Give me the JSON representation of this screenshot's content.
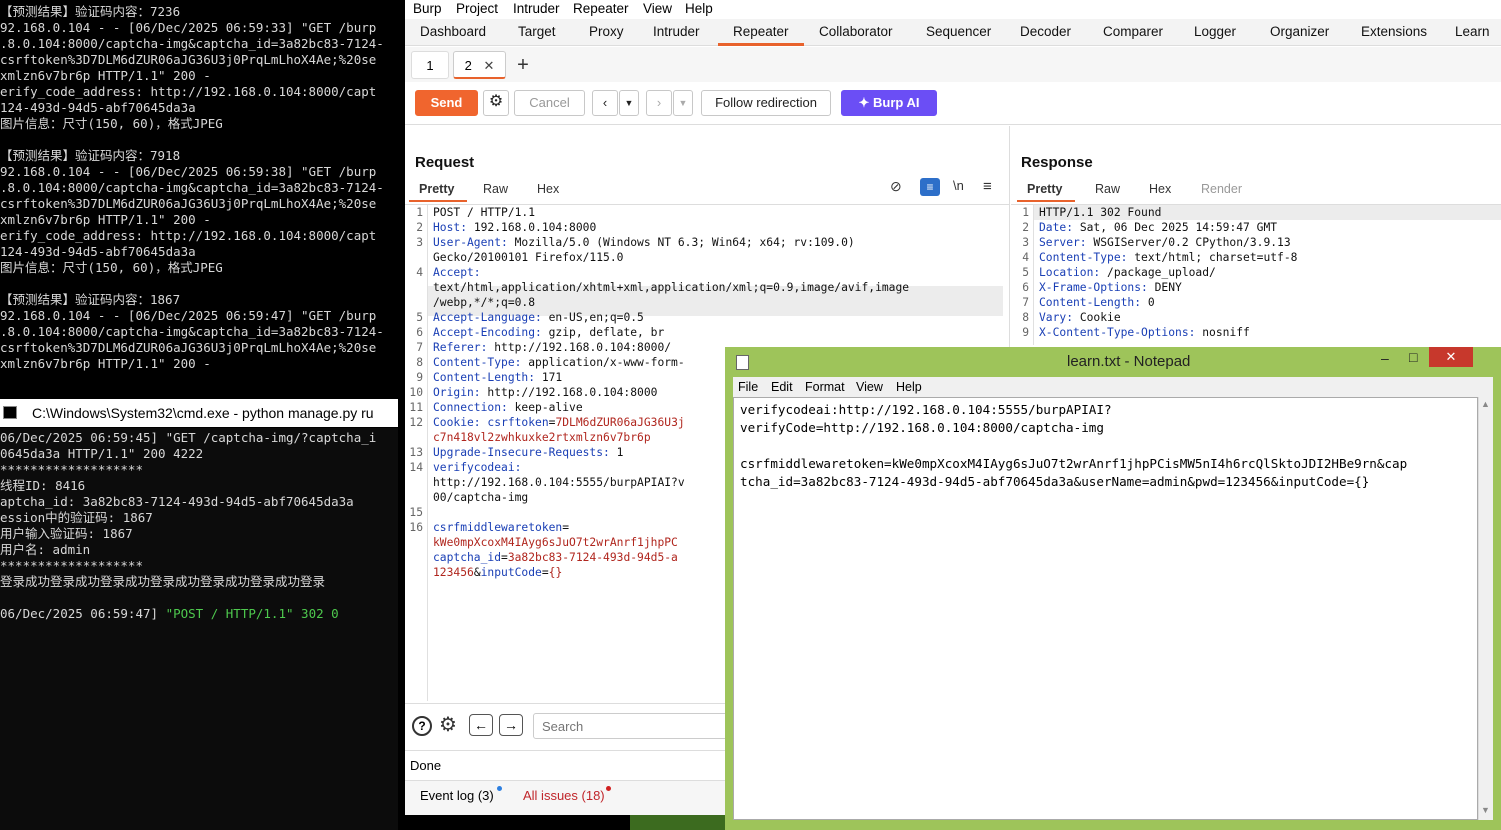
{
  "term1": {
    "lines": [
      "【预测结果】验证码内容：7236",
      "92.168.0.104 - - [06/Dec/2025 06:59:33] \"GET /burp",
      ".8.0.104:8000/captcha-img&captcha_id=3a82bc83-7124-",
      "csrftoken%3D7DLM6dZUR06aJG36U3j0PrqLmLhoX4Ae;%20se",
      "xmlzn6v7br6p HTTP/1.1\" 200 -",
      "erify_code_address: http://192.168.0.104:8000/capt",
      "124-493d-94d5-abf70645da3a",
      "图片信息：尺寸(150, 60)，格式JPEG",
      "",
      "【预测结果】验证码内容：7918",
      "92.168.0.104 - - [06/Dec/2025 06:59:38] \"GET /burp",
      ".8.0.104:8000/captcha-img&captcha_id=3a82bc83-7124-",
      "csrftoken%3D7DLM6dZUR06aJG36U3j0PrqLmLhoX4Ae;%20se",
      "xmlzn6v7br6p HTTP/1.1\" 200 -",
      "erify_code_address: http://192.168.0.104:8000/capt",
      "124-493d-94d5-abf70645da3a",
      "图片信息：尺寸(150, 60)，格式JPEG",
      "",
      "【预测结果】验证码内容：1867",
      "92.168.0.104 - - [06/Dec/2025 06:59:47] \"GET /burp",
      ".8.0.104:8000/captcha-img&captcha_id=3a82bc83-7124-",
      "csrftoken%3D7DLM6dZUR06aJG36U3j0PrqLmLhoX4Ae;%20se",
      "xmlzn6v7br6p HTTP/1.1\" 200 -"
    ]
  },
  "term2": {
    "title": "C:\\Windows\\System32\\cmd.exe - python  manage.py ru",
    "lines": [
      "06/Dec/2025 06:59:45] \"GET /captcha-img/?captcha_i",
      "0645da3a HTTP/1.1\" 200 4222",
      "*******************",
      "线程ID: 8416",
      "aptcha_id: 3a82bc83-7124-493d-94d5-abf70645da3a",
      "ession中的验证码: 1867",
      "用户输入验证码: 1867",
      "用户名: admin",
      "*******************",
      "登录成功登录成功登录成功登录成功登录成功登录成功登录",
      "",
      "06/Dec/2025 06:59:47] "
    ],
    "last_green": "\"POST / HTTP/1.1\" 302 0"
  },
  "burp": {
    "menu": [
      "Burp",
      "Project",
      "Intruder",
      "Repeater",
      "View",
      "Help"
    ],
    "tabs": [
      "Dashboard",
      "Target",
      "Proxy",
      "Intruder",
      "Repeater",
      "Collaborator",
      "Sequencer",
      "Decoder",
      "Comparer",
      "Logger",
      "Organizer",
      "Extensions",
      "Learn"
    ],
    "subtabs": [
      "1",
      "2"
    ],
    "toolbar": {
      "send": "Send",
      "cancel": "Cancel",
      "follow": "Follow redirection",
      "burp_ai": "Burp AI"
    },
    "request": {
      "title": "Request",
      "tabs": [
        "Pretty",
        "Raw",
        "Hex"
      ]
    },
    "response": {
      "title": "Response",
      "tabs": [
        "Pretty",
        "Raw",
        "Hex",
        "Render"
      ]
    },
    "search_placeholder": "Search",
    "status": "Done",
    "event_log": "Event log (3)",
    "all_issues": "All issues (18)",
    "colors": {
      "accent": "#e8622c",
      "send": "#f0652e",
      "ai": "#6b4ef5"
    }
  },
  "notepad": {
    "title": "learn.txt - Notepad",
    "menu": [
      "File",
      "Edit",
      "Format",
      "View",
      "Help"
    ],
    "text": "verifycodeai:http://192.168.0.104:5555/burpAPIAI?\nverifyCode=http://192.168.0.104:8000/captcha-img\n\ncsrfmiddlewaretoken=kWe0mpXcoxM4IAyg6sJuO7t2wrAnrf1jhpPCisMW5nI4h6rcQlSktoJDI2HBe9rn&cap\ntcha_id=3a82bc83-7124-493d-94d5-abf70645da3a&userName=admin&pwd=123456&inputCode={}"
  }
}
